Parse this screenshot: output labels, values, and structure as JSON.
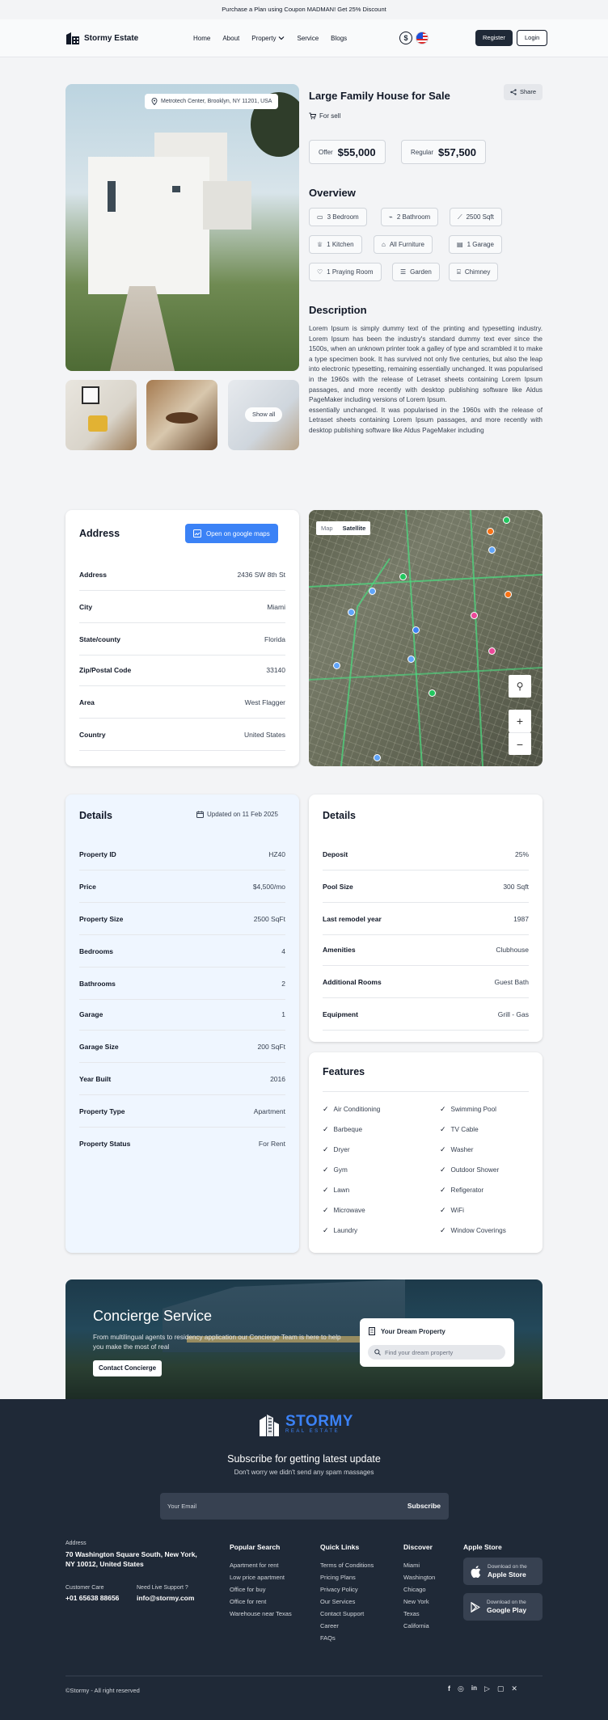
{
  "promo": "Purchase a Plan using Coupon MADMAN! Get 25% Discount",
  "nav": {
    "brand": "Stormy Estate",
    "links": [
      "Home",
      "About",
      "Property",
      "Service",
      "Blogs"
    ],
    "currency_symbol": "$",
    "register": "Register",
    "login": "Login"
  },
  "gallery": {
    "location": "Metrotech Center, Brooklyn, NY 11201, USA",
    "show_all": "Show all"
  },
  "listing": {
    "title": "Large Family House for Sale",
    "share": "Share",
    "status": "For sell",
    "offer_label": "Offer",
    "offer_price": "$55,000",
    "regular_label": "Regular",
    "regular_price": "$57,500"
  },
  "overview": {
    "title": "Overview",
    "items": [
      "3 Bedroom",
      "2 Bathroom",
      "2500 Sqft",
      "1 Kitchen",
      "All Furniture",
      "1 Garage",
      "1 Praying Room",
      "Garden",
      "Chimney"
    ]
  },
  "description": {
    "title": "Description",
    "text": "Lorem Ipsum is simply dummy text of the printing and typesetting industry. Lorem Ipsum has been the industry's standard dummy text ever since the 1500s, when an unknown printer took a galley of type and scrambled it to make a type specimen book. It has survived not only five centuries, but also the leap into electronic typesetting, remaining essentially unchanged. It was popularised in the 1960s with the release of Letraset sheets containing Lorem Ipsum passages, and more recently with desktop publishing software like Aldus PageMaker including versions of Lorem Ipsum.",
    "text2": "essentially unchanged. It was popularised in the 1960s with the release of Letraset sheets containing Lorem Ipsum passages, and more recently with desktop publishing software like Aldus PageMaker including"
  },
  "address": {
    "title": "Address",
    "maps_button": "Open on google maps",
    "rows": [
      {
        "k": "Address",
        "v": "2436 SW 8th St"
      },
      {
        "k": "City",
        "v": "Miami"
      },
      {
        "k": "State/county",
        "v": "Florida"
      },
      {
        "k": "Zip/Postal Code",
        "v": "33140"
      },
      {
        "k": "Area",
        "v": "West Flagger"
      },
      {
        "k": "Country",
        "v": "United States"
      }
    ]
  },
  "map": {
    "tab_map": "Map",
    "tab_satellite": "Satellite",
    "zoom_in": "+",
    "zoom_out": "−"
  },
  "details_left": {
    "title": "Details",
    "updated": "Updated on 11 Feb 2025",
    "rows": [
      {
        "k": "Property ID",
        "v": "HZ40"
      },
      {
        "k": "Price",
        "v": "$4,500/mo"
      },
      {
        "k": "Property Size",
        "v": "2500 SqFt"
      },
      {
        "k": "Bedrooms",
        "v": "4"
      },
      {
        "k": "Bathrooms",
        "v": "2"
      },
      {
        "k": "Garage",
        "v": "1"
      },
      {
        "k": "Garage Size",
        "v": "200 SqFt"
      },
      {
        "k": "Year Built",
        "v": "2016"
      },
      {
        "k": "Property Type",
        "v": "Apartment"
      },
      {
        "k": "Property Status",
        "v": "For Rent"
      }
    ]
  },
  "details_right": {
    "title": "Details",
    "rows": [
      {
        "k": "Deposit",
        "v": "25%"
      },
      {
        "k": "Pool Size",
        "v": "300 Sqft"
      },
      {
        "k": "Last remodel year",
        "v": "1987"
      },
      {
        "k": "Amenities",
        "v": "Clubhouse"
      },
      {
        "k": "Additional Rooms",
        "v": "Guest Bath"
      },
      {
        "k": "Equipment",
        "v": "Grill - Gas"
      }
    ]
  },
  "features": {
    "title": "Features",
    "left": [
      "Air Conditioning",
      "Barbeque",
      "Dryer",
      "Gym",
      "Lawn",
      "Microwave",
      "Laundry"
    ],
    "right": [
      "Swimming Pool",
      "TV Cable",
      "Washer",
      "Outdoor Shower",
      "Refigerator",
      "WiFi",
      "Window Coverings"
    ]
  },
  "concierge": {
    "title": "Concierge Service",
    "text": "From multilingual agents to residency application our Concierge Team is here to help you make the most of real",
    "button": "Contact Concierge",
    "card_title": "Your Dream Property",
    "search_placeholder": "Find your dream property"
  },
  "footer": {
    "brand": "STORMY",
    "brand_sub": "REAL ESTATE",
    "subscribe_title": "Subscribe for getting latest update",
    "subscribe_sub": "Don't worry we didn't send any spam massages",
    "email_placeholder": "Your Email",
    "subscribe_btn": "Subscribe",
    "address_label": "Address",
    "address": "70 Washington Square South, New York, NY 10012, United States",
    "care_label": "Customer Care",
    "care_phone": "+01 65638 88656",
    "support_label": "Need Live Support ?",
    "support_email": "info@stormy.com",
    "popular_title": "Popular Search",
    "popular": [
      "Apartment for rent",
      "Low price apartment",
      "Office for buy",
      "Office for rent",
      "Warehouse near Texas"
    ],
    "quick_title": "Quick Links",
    "quick": [
      "Terms of Conditions",
      "Pricing Plans",
      "Privacy Policy",
      "Our Services",
      "Contact Support",
      "Career",
      "FAQs"
    ],
    "discover_title": "Discover",
    "discover": [
      "Miami",
      "Washington",
      "Chicago",
      "New York",
      "Texas",
      "California"
    ],
    "apple_title": "Apple Store",
    "apple_small": "Download on the",
    "apple_big": "Apple Store",
    "google_small": "Download on the",
    "google_big": "Google Play",
    "copyright": "©Stormy - All right reserved"
  }
}
